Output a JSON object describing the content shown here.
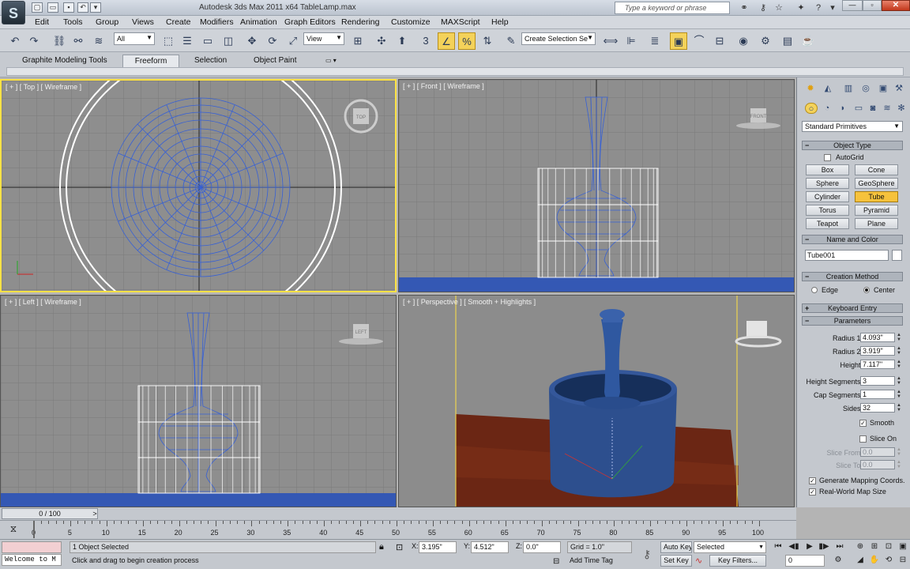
{
  "window": {
    "title": "Autodesk 3ds Max  2011 x64      TableLamp.max",
    "search_placeholder": "Type a keyword or phrase",
    "logo": "3ds-max-logo"
  },
  "menu": [
    "Edit",
    "Tools",
    "Group",
    "Views",
    "Create",
    "Modifiers",
    "Animation",
    "Graph Editors",
    "Rendering",
    "Customize",
    "MAXScript",
    "Help"
  ],
  "toolbar": {
    "selection_filter": "All",
    "ref_coord": "View",
    "snap_label": "3",
    "named_selection_placeholder": "Create Selection Se"
  },
  "ribbon": {
    "tabs": [
      "Graphite Modeling Tools",
      "Freeform",
      "Selection",
      "Object Paint"
    ],
    "active_tab": "Freeform"
  },
  "viewports": {
    "top": "[ + ] [ Top ] [ Wireframe ]",
    "front": "[ + ] [ Front ] [ Wireframe ]",
    "left": "[ + ] [ Left ] [ Wireframe ]",
    "perspective": "[ + ] [ Perspective ] [ Smooth + Highlights ]",
    "viewcube": {
      "top": "TOP",
      "front": "FRONT",
      "left": "LEFT"
    }
  },
  "command_panel": {
    "category": "Standard Primitives",
    "object_type": {
      "title": "Object Type",
      "autogrid": "AutoGrid",
      "buttons": [
        "Box",
        "Cone",
        "Sphere",
        "GeoSphere",
        "Cylinder",
        "Tube",
        "Torus",
        "Pyramid",
        "Teapot",
        "Plane"
      ],
      "active": "Tube"
    },
    "name_and_color": {
      "title": "Name and Color",
      "name": "Tube001"
    },
    "creation_method": {
      "title": "Creation Method",
      "options": [
        "Edge",
        "Center"
      ],
      "selected": "Center"
    },
    "keyboard_entry": "Keyboard Entry",
    "parameters": {
      "title": "Parameters",
      "radius1_label": "Radius 1:",
      "radius1": "4.093\"",
      "radius2_label": "Radius 2:",
      "radius2": "3.919\"",
      "height_label": "Height:",
      "height": "7.117\"",
      "height_segments_label": "Height Segments:",
      "height_segments": "3",
      "cap_segments_label": "Cap Segments:",
      "cap_segments": "1",
      "sides_label": "Sides:",
      "sides": "32",
      "smooth": "Smooth",
      "smooth_checked": true,
      "slice_on": "Slice On",
      "slice_on_checked": false,
      "slice_from_label": "Slice From:",
      "slice_from": "0.0",
      "slice_to_label": "Slice To:",
      "slice_to": "0.0",
      "gen_mapping": "Generate Mapping Coords.",
      "real_world": "Real-World Map Size"
    }
  },
  "timeline": {
    "frame": "0 / 100",
    "ticks": [
      "0",
      "5",
      "10",
      "15",
      "20",
      "25",
      "30",
      "35",
      "40",
      "45",
      "50",
      "55",
      "60",
      "65",
      "70",
      "75",
      "80",
      "85",
      "90",
      "95",
      "100"
    ]
  },
  "status": {
    "listener": "Welcome to M",
    "selected": "1 Object Selected",
    "prompt": "Click and drag to begin creation process",
    "x_label": "X:",
    "x": "3.195\"",
    "y_label": "Y:",
    "y": "4.512\"",
    "z_label": "Z:",
    "z": "0.0\"",
    "grid": "Grid = 1.0\"",
    "add_time_tag": "Add Time Tag",
    "auto_key": "Auto Key",
    "set_key": "Set Key",
    "key_mode": "Selected",
    "key_filters": "Key Filters...",
    "current_frame": "0"
  }
}
